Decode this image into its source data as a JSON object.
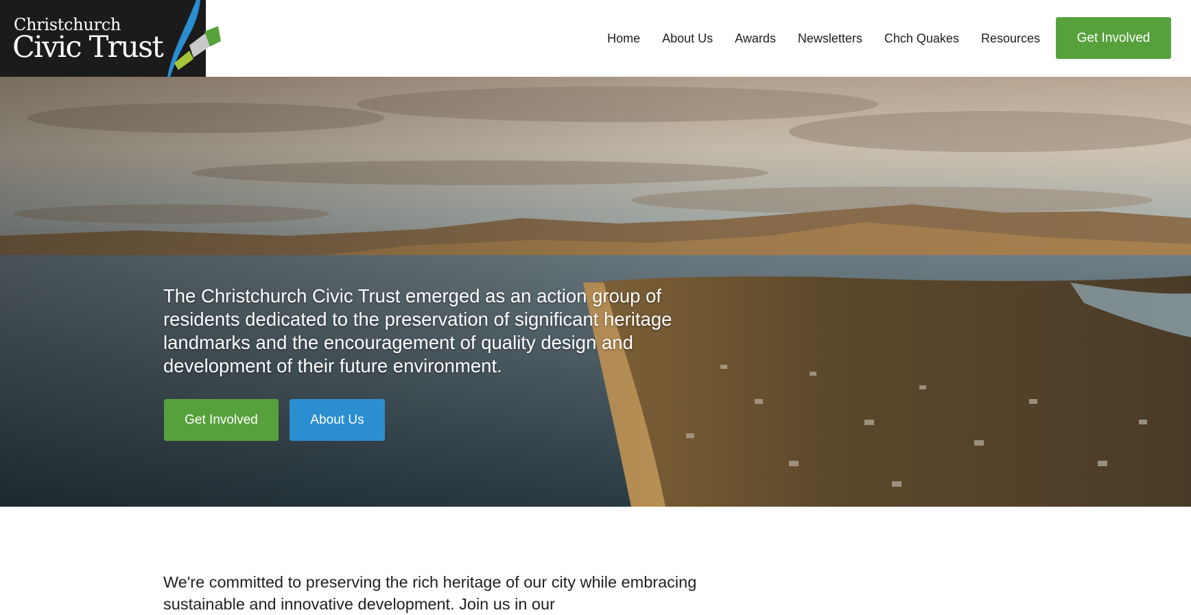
{
  "brand": {
    "line1": "Christchurch",
    "line2": "Civic Trust"
  },
  "nav": {
    "items": [
      {
        "label": "Home"
      },
      {
        "label": "About Us"
      },
      {
        "label": "Awards"
      },
      {
        "label": "Newsletters"
      },
      {
        "label": "Chch Quakes"
      },
      {
        "label": "Resources"
      }
    ],
    "cta_label": "Get Involved"
  },
  "hero": {
    "text": "The Christchurch Civic Trust emerged as an action group of residents dedicated to the preservation of significant heritage landmarks and the encouragement of quality design and development of their future environment.",
    "primary_button": "Get Involved",
    "secondary_button": "About Us"
  },
  "intro": {
    "text": "We're committed to preserving the rich heritage of our city while embracing sustainable and innovative development. Join us in our"
  },
  "colors": {
    "green": "#57a13d",
    "blue": "#2a8ed1",
    "logo_bg": "#1b1b1b"
  }
}
